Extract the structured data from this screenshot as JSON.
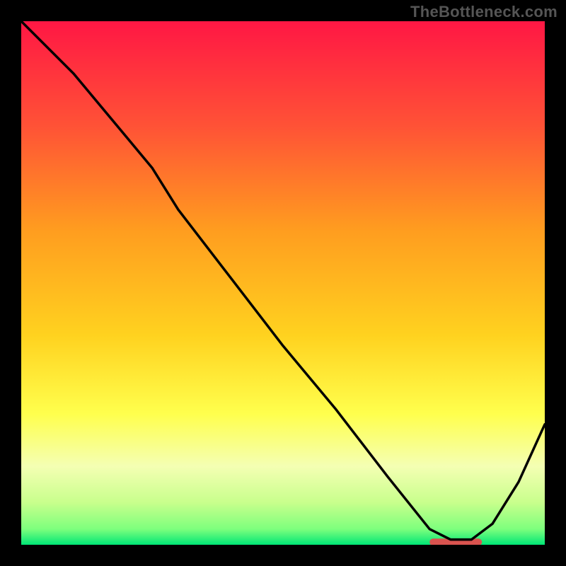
{
  "watermark": "TheBottleneck.com",
  "chart_data": {
    "type": "line",
    "title": "",
    "xlabel": "",
    "ylabel": "",
    "xlim": [
      0,
      100
    ],
    "ylim": [
      0,
      100
    ],
    "grid": false,
    "legend": false,
    "annotations": [],
    "series": [
      {
        "name": "curve",
        "color": "#000000",
        "x": [
          0,
          10,
          20,
          25,
          30,
          40,
          50,
          60,
          70,
          78,
          82,
          86,
          90,
          95,
          100
        ],
        "y": [
          100,
          90,
          78,
          72,
          64,
          51,
          38,
          26,
          13,
          3,
          1,
          1,
          4,
          12,
          23
        ]
      }
    ],
    "optimal_marker": {
      "x_start": 78,
      "x_end": 88,
      "y": 0.5,
      "color": "#d9534f",
      "thickness": 10
    },
    "background_gradient": {
      "stops": [
        {
          "offset": 0,
          "color": "#ff1744"
        },
        {
          "offset": 20,
          "color": "#ff5236"
        },
        {
          "offset": 40,
          "color": "#ff9d1f"
        },
        {
          "offset": 60,
          "color": "#ffd21f"
        },
        {
          "offset": 75,
          "color": "#ffff4d"
        },
        {
          "offset": 85,
          "color": "#f4ffb3"
        },
        {
          "offset": 92,
          "color": "#c8ff8c"
        },
        {
          "offset": 97,
          "color": "#7dff7d"
        },
        {
          "offset": 100,
          "color": "#00e676"
        }
      ]
    }
  }
}
